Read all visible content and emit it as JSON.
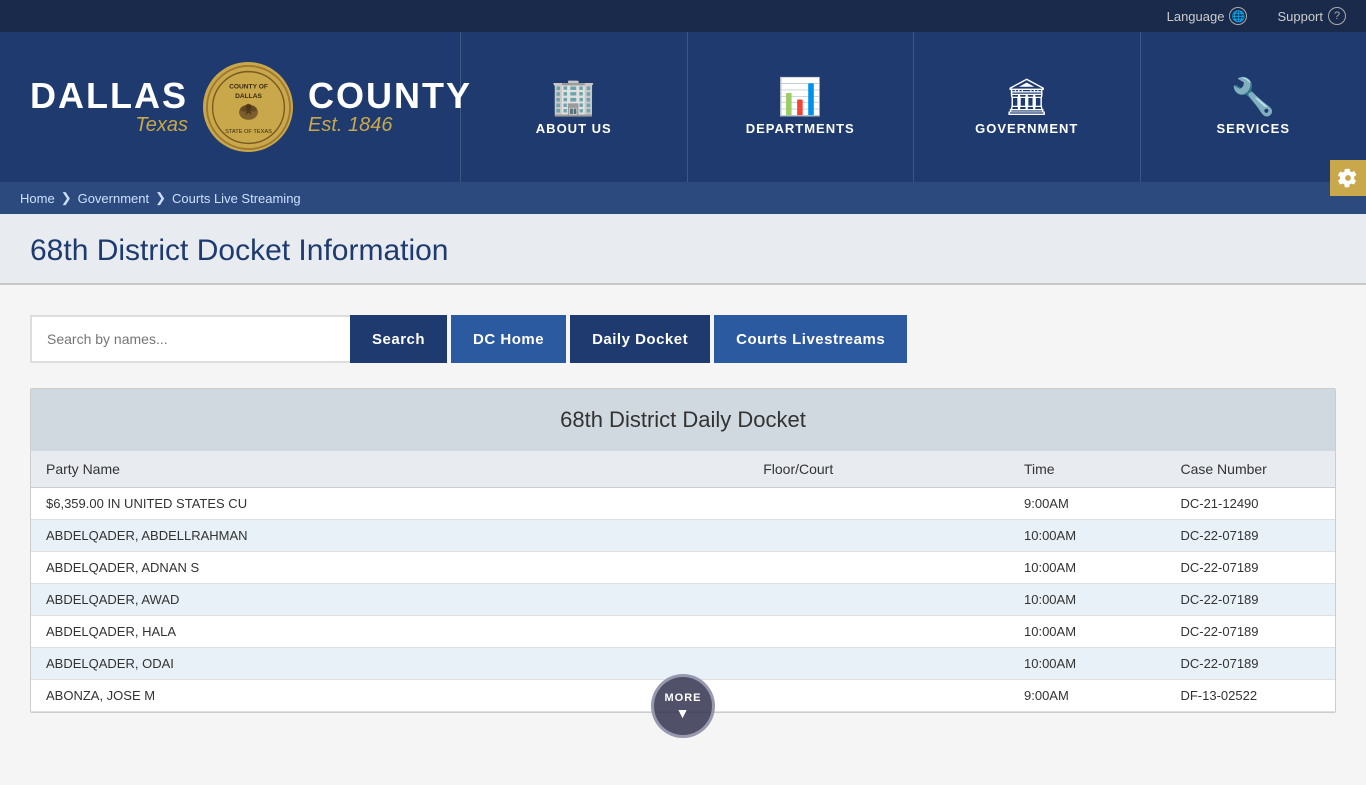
{
  "topbar": {
    "language_label": "Language",
    "support_label": "Support"
  },
  "header": {
    "logo": {
      "left_name": "DALLAS",
      "left_sub": "Texas",
      "right_name": "COUNTY",
      "right_sub": "Est. 1846",
      "seal_alt": "County of Dallas, State of Texas seal"
    },
    "nav": [
      {
        "id": "about-us",
        "label": "ABOUT US",
        "icon": "🏢"
      },
      {
        "id": "departments",
        "label": "DEPARTMENTS",
        "icon": "📊"
      },
      {
        "id": "government",
        "label": "GOVERNMENT",
        "icon": "🏛"
      },
      {
        "id": "services",
        "label": "SERVICES",
        "icon": "🔧"
      }
    ]
  },
  "breadcrumb": {
    "items": [
      {
        "label": "Home",
        "href": "#"
      },
      {
        "label": "Government",
        "href": "#"
      },
      {
        "label": "Courts Live Streaming",
        "href": "#"
      }
    ]
  },
  "page": {
    "title": "68th District Docket Information"
  },
  "search": {
    "placeholder": "Search by names...",
    "search_btn": "Search",
    "dc_home_btn": "DC Home",
    "daily_docket_btn": "Daily Docket",
    "courts_live_btn": "Courts Livestreams"
  },
  "table": {
    "title": "68th District Daily Docket",
    "columns": {
      "party_name": "Party Name",
      "floor_court": "Floor/Court",
      "time": "Time",
      "case_number": "Case Number"
    },
    "rows": [
      {
        "party": "$6,359.00 IN UNITED STATES CU",
        "floor": "",
        "time": "9:00AM",
        "case": "DC-21-12490"
      },
      {
        "party": "ABDELQADER, ABDELLRAHMAN",
        "floor": "",
        "time": "10:00AM",
        "case": "DC-22-07189"
      },
      {
        "party": "ABDELQADER, ADNAN S",
        "floor": "",
        "time": "10:00AM",
        "case": "DC-22-07189"
      },
      {
        "party": "ABDELQADER, AWAD",
        "floor": "",
        "time": "10:00AM",
        "case": "DC-22-07189"
      },
      {
        "party": "ABDELQADER, HALA",
        "floor": "",
        "time": "10:00AM",
        "case": "DC-22-07189"
      },
      {
        "party": "ABDELQADER, ODAI",
        "floor": "",
        "time": "10:00AM",
        "case": "DC-22-07189"
      },
      {
        "party": "ABONZA, JOSE M",
        "floor": "",
        "time": "9:00AM",
        "case": "DF-13-02522"
      }
    ]
  },
  "more_button": "MORE"
}
